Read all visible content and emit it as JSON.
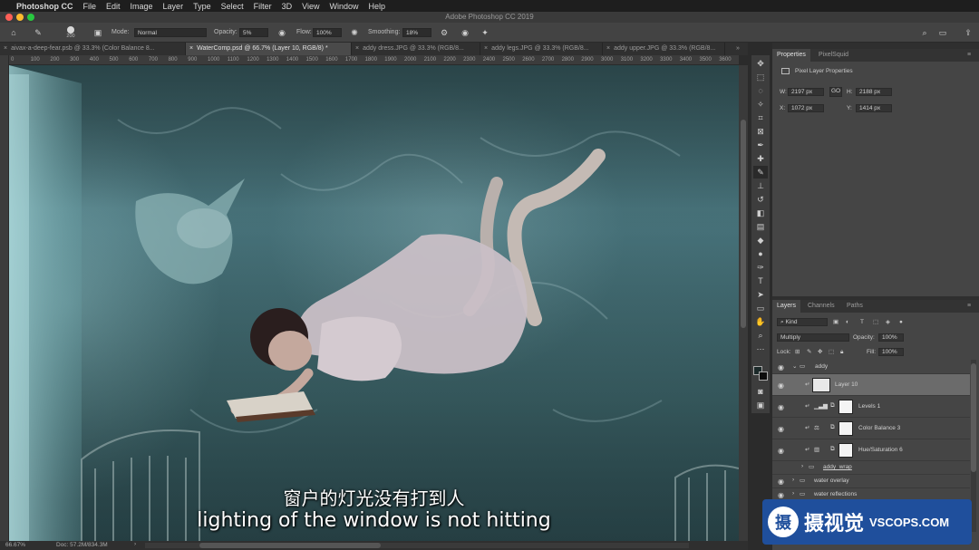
{
  "menubar": {
    "apple": "",
    "app": "Photoshop CC",
    "items": [
      "File",
      "Edit",
      "Image",
      "Layer",
      "Type",
      "Select",
      "Filter",
      "3D",
      "View",
      "Window",
      "Help"
    ]
  },
  "window_title": "Adobe Photoshop CC 2019",
  "options": {
    "brush_size": "200",
    "mode_label": "Mode:",
    "mode_value": "Normal",
    "opacity_label": "Opacity:",
    "opacity_value": "5%",
    "flow_label": "Flow:",
    "flow_value": "100%",
    "smoothing_label": "Smoothing:",
    "smoothing_value": "18%"
  },
  "doc_tabs": [
    {
      "label": "aivax-a-deep-fear.psb @ 33.3% (Color Balance 8..."
    },
    {
      "label": "WaterComp.psd @ 66.7% (Layer 10, RGB/8) *"
    },
    {
      "label": "addy dress.JPG @ 33.3% (RGB/8..."
    },
    {
      "label": "addy legs.JPG @ 33.3% (RGB/8..."
    },
    {
      "label": "addy upper.JPG @ 33.3% (RGB/8..."
    }
  ],
  "ruler_ticks": [
    "0",
    "100",
    "200",
    "300",
    "400",
    "500",
    "600",
    "700",
    "800",
    "900",
    "1000",
    "1100",
    "1200",
    "1300",
    "1400",
    "1500",
    "1600",
    "1700",
    "1800",
    "1900",
    "2000",
    "2100",
    "2200",
    "2300",
    "2400",
    "2500",
    "2600",
    "2700",
    "2800",
    "2900",
    "3000",
    "3100",
    "3200",
    "3300",
    "3400",
    "3500",
    "3600"
  ],
  "status": {
    "zoom": "66.67%",
    "doc": "Doc: 57.2M/834.3M"
  },
  "subtitles": {
    "chinese": "窗户的灯光没有打到人",
    "english": "lighting of the window is not hitting"
  },
  "properties": {
    "tabs": [
      "Properties",
      "PixelSquid"
    ],
    "heading": "Pixel Layer Properties",
    "w_label": "W:",
    "w_value": "2197 px",
    "h_label": "H:",
    "h_value": "2188 px",
    "x_label": "X:",
    "x_value": "1072 px",
    "y_label": "Y:",
    "y_value": "1414 px",
    "link": "GO"
  },
  "layers_panel": {
    "tabs": [
      "Layers",
      "Channels",
      "Paths"
    ],
    "kind": "Kind",
    "blend_mode": "Multiply",
    "opacity_label": "Opacity:",
    "opacity_value": "100%",
    "lock_label": "Lock:",
    "fill_label": "Fill:",
    "fill_value": "100%",
    "layers": [
      {
        "name": "addy"
      },
      {
        "name": "Layer 10"
      },
      {
        "name": "Levels 1"
      },
      {
        "name": "Color Balance 3"
      },
      {
        "name": "Hue/Saturation 6"
      },
      {
        "name": "addy_wrap"
      },
      {
        "name": "water overlay"
      },
      {
        "name": "water reflections"
      }
    ]
  },
  "watermark": {
    "brand_cn": "摄视觉",
    "brand_en": "VSCOPS.COM"
  }
}
